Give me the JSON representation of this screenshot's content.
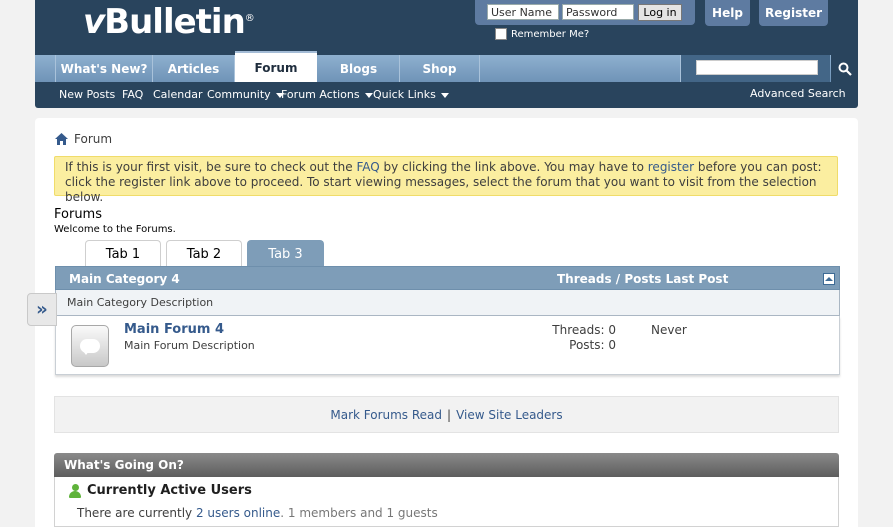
{
  "header": {
    "logo_text": "Bulletin",
    "logo_v": "v",
    "logo_reg": "®",
    "login": {
      "username_placeholder": "User Name",
      "password_placeholder": "Password",
      "login_label": "Log in",
      "remember_label": "Remember Me?"
    },
    "help_label": "Help",
    "register_label": "Register"
  },
  "nav": {
    "tabs": [
      {
        "label": "What's New?"
      },
      {
        "label": "Articles"
      },
      {
        "label": "Forum"
      },
      {
        "label": "Blogs"
      },
      {
        "label": "Shop"
      }
    ],
    "active_tab": "Forum"
  },
  "subnav": {
    "items": [
      {
        "label": "New Posts"
      },
      {
        "label": "FAQ"
      },
      {
        "label": "Calendar"
      },
      {
        "label": "Community"
      },
      {
        "label": "Forum Actions"
      },
      {
        "label": "Quick Links"
      }
    ],
    "advanced_search": "Advanced Search"
  },
  "breadcrumb": {
    "label": "Forum"
  },
  "notice": {
    "part1": "If this is your first visit, be sure to check out the ",
    "faq_link": "FAQ",
    "part2": " by clicking the link above. You may have to ",
    "register_link": "register",
    "part3": " before you can post: click the register link above to proceed. To start viewing messages, select the forum that you want to visit from the selection below."
  },
  "forums": {
    "title": "Forums",
    "subtitle": "Welcome to the Forums.",
    "tabs": [
      "Tab 1",
      "Tab 2",
      "Tab 3"
    ],
    "category": {
      "title": "Main Category 4",
      "columns": "Threads / Posts Last Post",
      "description": "Main Category Description"
    },
    "forum": {
      "name": "Main Forum 4",
      "description": "Main Forum Description",
      "threads": "Threads: 0",
      "posts": "Posts: 0",
      "last_post": "Never"
    },
    "side_tab_glyph": "»"
  },
  "actions": {
    "mark_read": "Mark Forums Read",
    "separator": "|",
    "site_leaders": "View Site Leaders"
  },
  "whats_going_on": {
    "title": "What's Going On?",
    "active_users_title": "Currently Active Users",
    "line_prefix": "There are currently ",
    "users_online_link": "2 users online",
    "line_suffix": ". 1 members and 1 guests"
  },
  "colors": {
    "header_bg": "#29445d",
    "nav_bg": "#7e9db8",
    "link": "#355a8c",
    "notice_bg": "#fbeea0"
  }
}
